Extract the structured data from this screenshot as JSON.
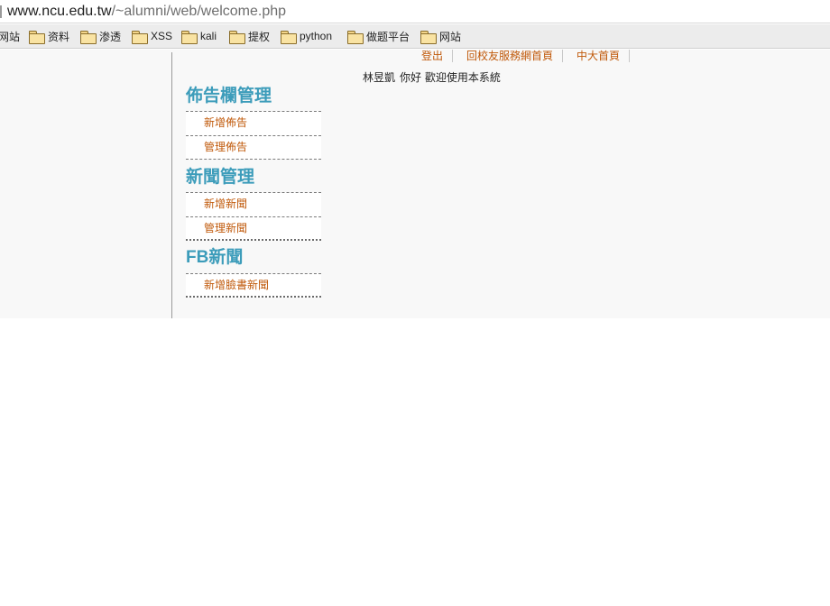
{
  "browser": {
    "url_host": "www.ncu.edu.tw",
    "url_path": "/~alumni/web/welcome.php",
    "bookmarks": [
      "网站",
      "资料",
      "渗透",
      "XSS",
      "kali",
      "提权",
      "python",
      "做题平台",
      "网站"
    ]
  },
  "header": {
    "links": [
      "登出",
      "回校友服務網首頁",
      "中大首頁"
    ],
    "welcome_name": "林昱凱",
    "welcome_text": "你好 歡迎使用本系統"
  },
  "menu": {
    "sections": [
      {
        "title": "佈告欄管理",
        "items": [
          "新增佈告",
          "管理佈告"
        ]
      },
      {
        "title": "新聞管理",
        "items": [
          "新增新聞",
          "管理新聞"
        ]
      },
      {
        "title": "FB新聞",
        "items": [
          "新增臉書新聞"
        ]
      }
    ]
  },
  "colors": {
    "link": "#c0590a",
    "section_title": "#3c9cba",
    "page_bg": "#f8f8f8",
    "bookmarks_bg": "#ececec"
  }
}
